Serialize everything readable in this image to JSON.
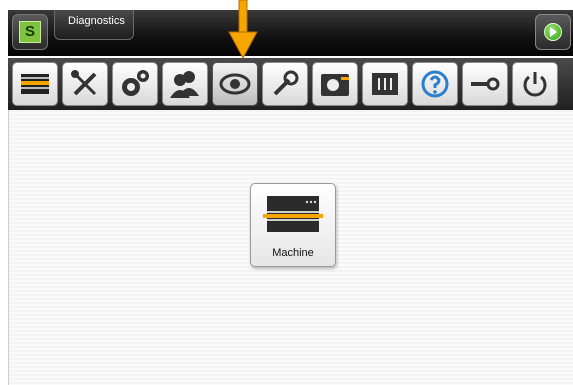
{
  "header": {
    "title": "Diagnostics",
    "logo_letter": "S",
    "logo_icon": "s-logo-icon",
    "exit_icon": "go-forward-icon"
  },
  "toolbar": {
    "items": [
      {
        "icon": "production-icon"
      },
      {
        "icon": "tools-icon"
      },
      {
        "icon": "gears-icon"
      },
      {
        "icon": "users-icon"
      },
      {
        "icon": "eye-icon",
        "active": true
      },
      {
        "icon": "wrench-icon"
      },
      {
        "icon": "folder-camera-icon"
      },
      {
        "icon": "mixer-icon"
      },
      {
        "icon": "help-icon"
      },
      {
        "icon": "key-icon"
      },
      {
        "icon": "power-icon"
      }
    ],
    "indicator_icon": "down-arrow-icon"
  },
  "main": {
    "buttons": [
      {
        "label": "Machine",
        "icon": "machine-icon"
      }
    ]
  },
  "colors": {
    "accent_orange": "#f7a600",
    "green": "#7fc241",
    "header_dark": "#111111"
  }
}
